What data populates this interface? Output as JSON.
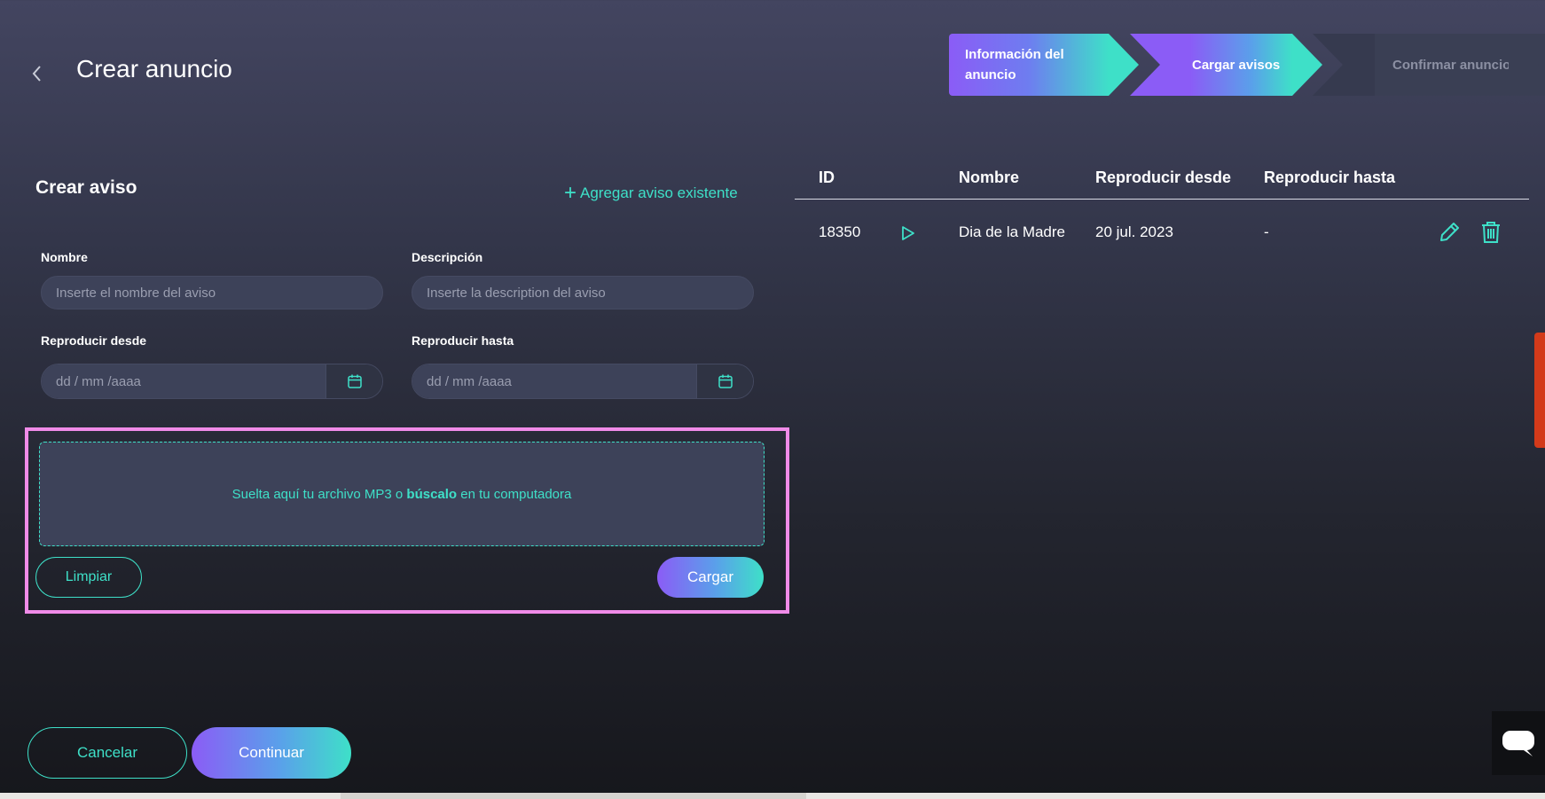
{
  "header": {
    "title": "Crear anuncio",
    "back_icon": "chevron-left-icon"
  },
  "stepper": {
    "steps": [
      {
        "label": "Información del anuncio",
        "state": "done"
      },
      {
        "label": "Cargar avisos",
        "state": "active"
      },
      {
        "label": "Confirmar anuncio",
        "state": "pending"
      }
    ]
  },
  "form": {
    "title": "Crear aviso",
    "add_existing": "Agregar aviso existente",
    "name_label": "Nombre",
    "name_placeholder": "Inserte el nombre del aviso",
    "desc_label": "Descripción",
    "desc_placeholder": "Inserte la description del aviso",
    "from_label": "Reproducir desde",
    "from_placeholder": "dd / mm /aaaa",
    "to_label": "Reproducir hasta",
    "to_placeholder": "dd / mm /aaaa"
  },
  "upload": {
    "text_before": "Suelta aquí tu archivo MP3 o ",
    "text_link": "búscalo",
    "text_after": " en tu computadora",
    "clear_label": "Limpiar",
    "upload_label": "Cargar"
  },
  "table": {
    "headers": [
      "ID",
      "Nombre",
      "Reproducir desde",
      "Reproducir hasta"
    ],
    "rows": [
      {
        "id": "18350",
        "name": "Dia de la Madre",
        "from": "20 jul. 2023",
        "to": "-"
      }
    ]
  },
  "footer": {
    "cancel_label": "Cancelar",
    "continue_label": "Continuar"
  },
  "colors": {
    "accent": "#3ee0c8",
    "purple": "#8b5cf6",
    "highlight": "#f08be8"
  }
}
